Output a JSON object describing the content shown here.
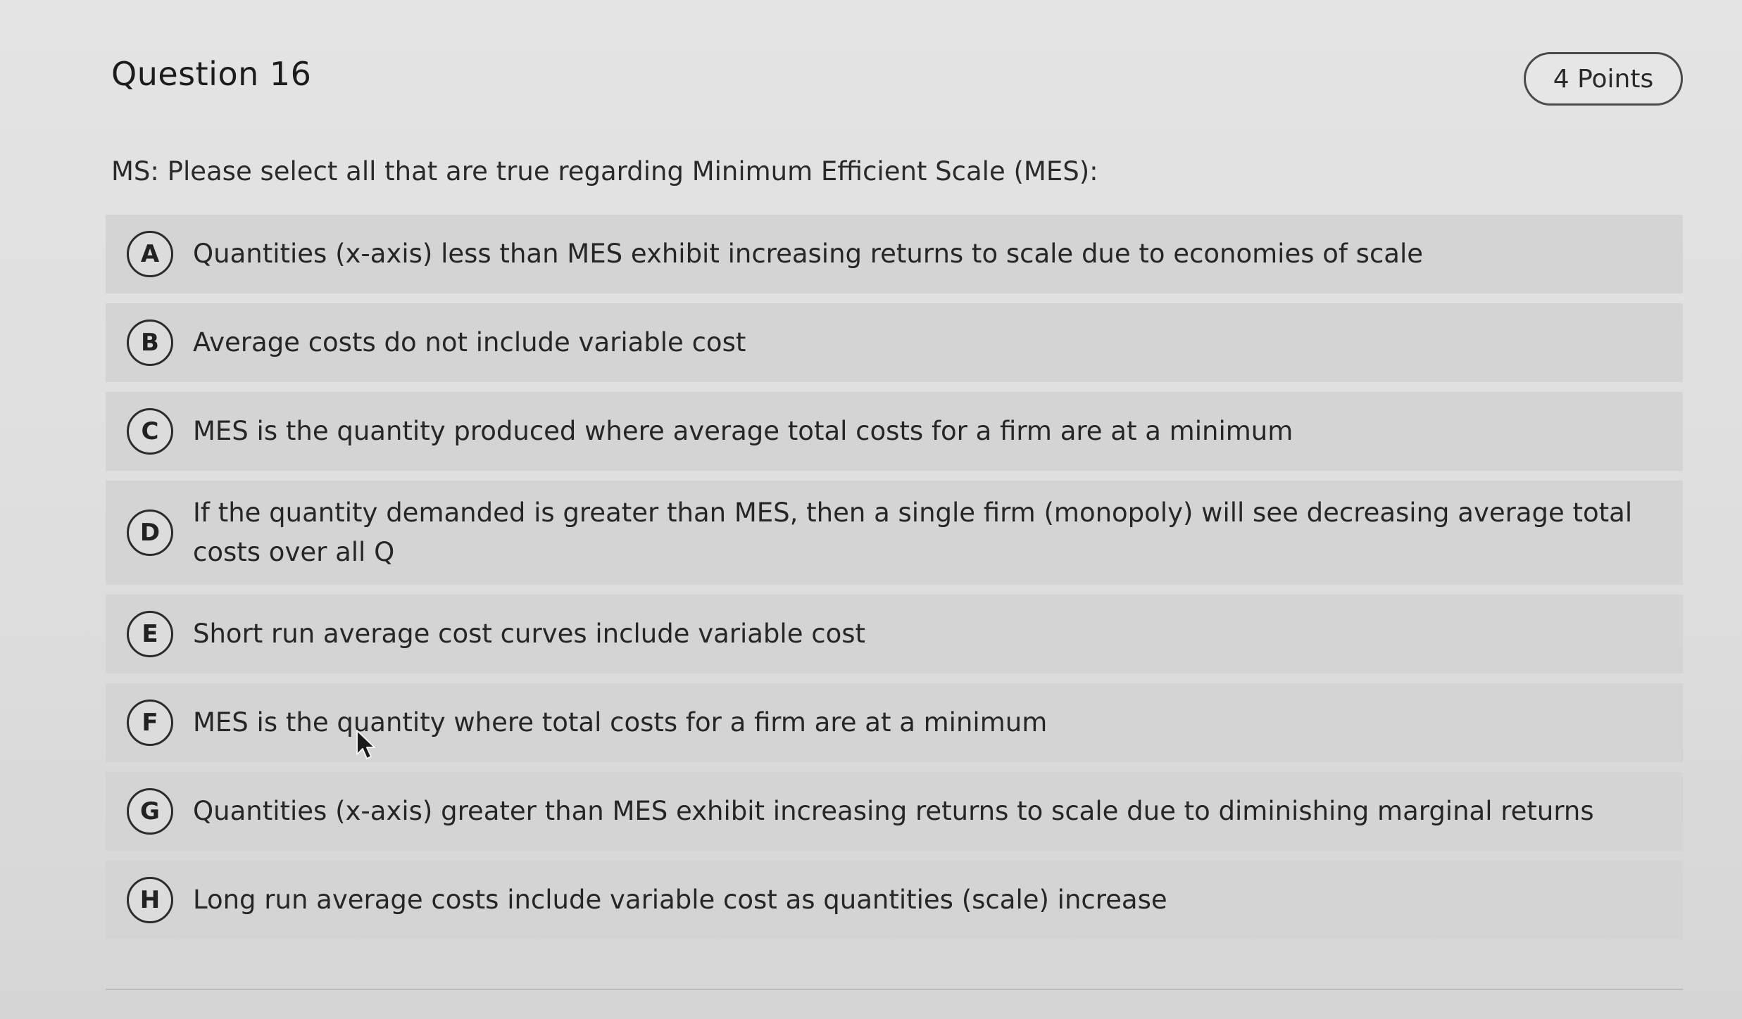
{
  "question": {
    "title": "Question 16",
    "points": "4 Points",
    "prompt": "MS: Please select all that are true regarding Minimum Efficient Scale (MES):"
  },
  "options": [
    {
      "letter": "A",
      "text": "Quantities (x-axis) less than MES exhibit increasing returns to scale due to economies of scale"
    },
    {
      "letter": "B",
      "text": "Average costs do not include variable cost"
    },
    {
      "letter": "C",
      "text": "MES is the quantity produced where average total costs for a firm are at a minimum"
    },
    {
      "letter": "D",
      "text": "If the quantity demanded is greater than MES, then a single firm (monopoly) will see decreasing average total costs over all Q"
    },
    {
      "letter": "E",
      "text": "Short run average cost curves include variable cost"
    },
    {
      "letter": "F",
      "text": "MES is the quantity where total costs for a firm are at a minimum"
    },
    {
      "letter": "G",
      "text": "Quantities (x-axis) greater than MES exhibit increasing returns to scale due to diminishing marginal returns"
    },
    {
      "letter": "H",
      "text": "Long run average costs include variable cost as quantities (scale) increase"
    }
  ],
  "icons": {
    "cursor": "mouse-pointer-icon"
  }
}
